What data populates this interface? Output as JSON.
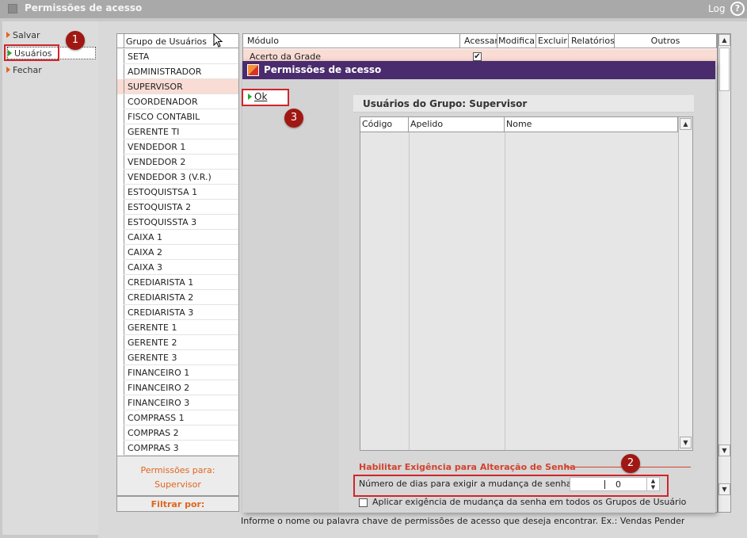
{
  "window": {
    "title": "Permissões de acesso",
    "log_label": "Log",
    "help_label": "?"
  },
  "sidebar": {
    "actions": [
      {
        "label": "Salvar"
      },
      {
        "label": "Usuários"
      },
      {
        "label": "Fechar"
      }
    ]
  },
  "groups": {
    "header": "Grupo de Usuários",
    "items": [
      "SETA",
      "ADMINISTRADOR",
      "SUPERVISOR",
      "COORDENADOR",
      "FISCO CONTABIL",
      "GERENTE TI",
      "VENDEDOR 1",
      "VENDEDOR 2",
      "VENDEDOR 3 (V.R.)",
      "ESTOQUISTSA 1",
      "ESTOQUISTA 2",
      "ESTOQUISSTA 3",
      "CAIXA 1",
      "CAIXA 2",
      "CAIXA 3",
      "CREDIARISTA 1",
      "CREDIARISTA 2",
      "CREDIARISTA 3",
      "GERENTE 1",
      "GERENTE 2",
      "GERENTE 3",
      "FINANCEIRO 1",
      "FINANCEIRO 2",
      "FINANCEIRO 3",
      "COMPRASS 1",
      "COMPRAS 2",
      "COMPRAS 3"
    ],
    "selected": "SUPERVISOR",
    "permissions_for_label": "Permissões para:",
    "permissions_for_value": "Supervisor",
    "filter_label": "Filtrar por:"
  },
  "modules": {
    "columns": [
      "Módulo",
      "Acessar",
      "Modifica",
      "Excluir",
      "Relatórios",
      "Outros"
    ],
    "rows": [
      {
        "name": "Acerto da Grade",
        "acessar": "✔"
      }
    ]
  },
  "bottom_hint": "Informe o nome ou palavra chave de permissões de acesso que deseja encontrar. Ex.: Vendas Pendentes",
  "dialog": {
    "title": "Permissões de acesso",
    "ok_label": "Ok",
    "panel_title": "Usuários do Grupo: Supervisor",
    "user_columns": [
      "Código",
      "Apelido",
      "Nome"
    ],
    "section_title": "Habilitar Exigência para Alteração de Senha",
    "days_label": "Número de dias para exigir a mudança de senha:",
    "days_value": "0",
    "apply_all_label": "Aplicar exigência de mudança da senha em todos os Grupos de Usuário"
  },
  "annotations": [
    "1",
    "2",
    "3"
  ],
  "colors": {
    "accent_orange": "#e0661f",
    "selection": "#f9dcd4",
    "dialog_title": "#4a2b6d",
    "highlight_red": "#d0252b"
  }
}
